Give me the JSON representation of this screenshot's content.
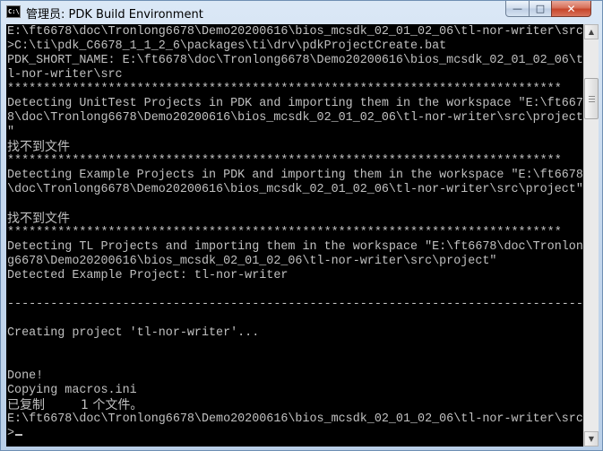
{
  "window": {
    "title": "管理员: PDK Build Environment",
    "icon_label": "C:\\",
    "controls": {
      "minimize": "—",
      "maximize": "□",
      "close": "✕"
    }
  },
  "console": {
    "lines": [
      "E:\\ft6678\\doc\\Tronlong6678\\Demo20200616\\bios_mcsdk_02_01_02_06\\tl-nor-writer\\src",
      ">C:\\ti\\pdk_C6678_1_1_2_6\\packages\\ti\\drv\\pdkProjectCreate.bat",
      "PDK_SHORT_NAME: E:\\ft6678\\doc\\Tronlong6678\\Demo20200616\\bios_mcsdk_02_01_02_06\\t",
      "l-nor-writer\\src",
      "*****************************************************************************",
      "Detecting UnitTest Projects in PDK and importing them in the workspace \"E:\\ft667",
      "8\\doc\\Tronlong6678\\Demo20200616\\bios_mcsdk_02_01_02_06\\tl-nor-writer\\src\\project",
      "\"",
      "找不到文件",
      "*****************************************************************************",
      "Detecting Example Projects in PDK and importing them in the workspace \"E:\\ft6678",
      "\\doc\\Tronlong6678\\Demo20200616\\bios_mcsdk_02_01_02_06\\tl-nor-writer\\src\\project\"",
      "",
      "找不到文件",
      "*****************************************************************************",
      "Detecting TL Projects and importing them in the workspace \"E:\\ft6678\\doc\\Tronlon",
      "g6678\\Demo20200616\\bios_mcsdk_02_01_02_06\\tl-nor-writer\\src\\project\"",
      "Detected Example Project: tl-nor-writer",
      "",
      "--------------------------------------------------------------------------------",
      "",
      "Creating project 'tl-nor-writer'...",
      "",
      "",
      "Done!",
      "Copying macros.ini",
      "已复制         1 个文件。",
      "E:\\ft6678\\doc\\Tronlong6678\\Demo20200616\\bios_mcsdk_02_01_02_06\\tl-nor-writer\\src",
      ">"
    ]
  },
  "scrollbar": {
    "up_arrow": "▲",
    "down_arrow": "▼"
  },
  "colors": {
    "console_bg": "#000000",
    "console_text": "#c0c0c0",
    "close_button": "#c7462b"
  }
}
